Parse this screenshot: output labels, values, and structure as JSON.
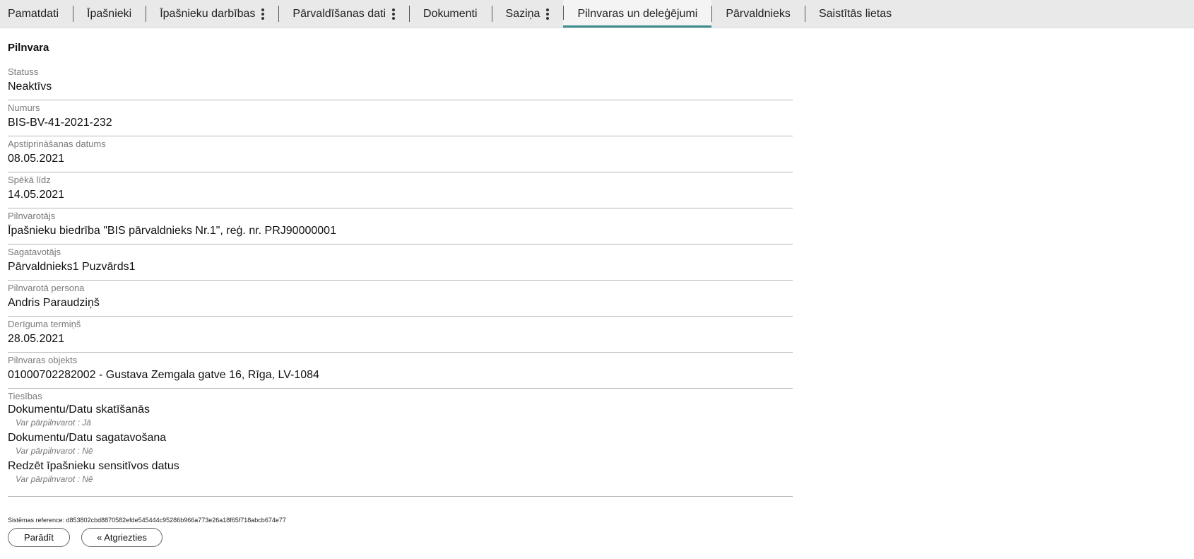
{
  "tabs": [
    {
      "label": "Pamatdati"
    },
    {
      "label": "Īpašnieki"
    },
    {
      "label": "Īpašnieku darbības"
    },
    {
      "label": "Pārvaldīšanas dati"
    },
    {
      "label": "Dokumenti"
    },
    {
      "label": "Saziņa"
    },
    {
      "label": "Pilnvaras un deleģējumi"
    },
    {
      "label": "Pārvaldnieks"
    },
    {
      "label": "Saistītās lietas"
    }
  ],
  "active_tab": "Pilnvaras un deleģējumi",
  "section_title": "Pilnvara",
  "fields": [
    {
      "label": "Statuss",
      "value": "Neaktīvs"
    },
    {
      "label": "Numurs",
      "value": "BIS-BV-41-2021-232"
    },
    {
      "label": "Apstiprināšanas datums",
      "value": "08.05.2021"
    },
    {
      "label": "Spēkā līdz",
      "value": "14.05.2021"
    },
    {
      "label": "Pilnvarotājs",
      "value": "Īpašnieku biedrība \"BIS pārvaldnieks Nr.1\", reģ. nr. PRJ90000001"
    },
    {
      "label": "Sagatavotājs",
      "value": "Pārvaldnieks1 Puzvārds1"
    },
    {
      "label": "Pilnvarotā persona",
      "value": "Andris Paraudziņš"
    },
    {
      "label": "Derīguma termiņš",
      "value": "28.05.2021"
    },
    {
      "label": "Pilnvaras objekts",
      "value": "01000702282002 - Gustava Zemgala gatve 16, Rīga, LV-1084"
    }
  ],
  "rights": {
    "label": "Tiesības",
    "items": [
      {
        "name": "Dokumentu/Datu skatīšanās",
        "sub": "Var pārpilnvarot : Jā"
      },
      {
        "name": "Dokumentu/Datu sagatavošana",
        "sub": "Var pārpilnvarot : Nē"
      },
      {
        "name": "Redzēt īpašnieku sensitīvos datus",
        "sub": "Var pārpilnvarot : Nē"
      }
    ]
  },
  "system_reference": "Sistēmas reference: d853802cbd8870582efde545444c95286b966a773e26a18f65f718abcb674e77",
  "buttons": {
    "show": "Parādīt",
    "back": "« Atgriezties"
  },
  "colors": {
    "active_tab_underline": "#3b8c8c",
    "tabbar_bg": "#e9e9e9"
  },
  "icons": {
    "tab_menu": "kebab-menu-icon"
  }
}
